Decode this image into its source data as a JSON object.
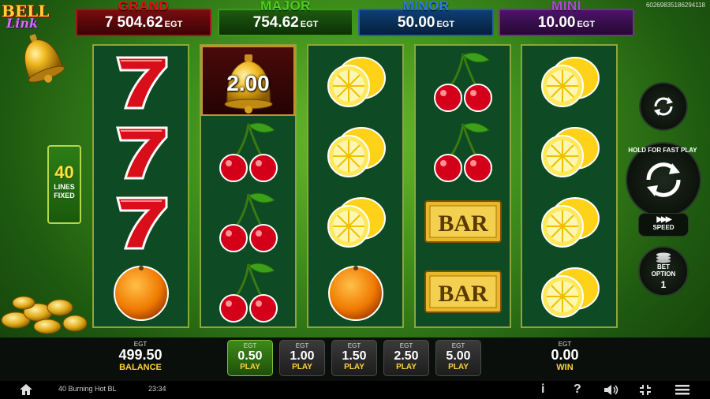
{
  "logo": {
    "title": "BELL",
    "subtitle": "Link"
  },
  "game_id": "60269835186294118",
  "jackpots": [
    {
      "name": "GRAND",
      "value": "7 504.62",
      "currency": "EGT"
    },
    {
      "name": "MAJOR",
      "value": "754.62",
      "currency": "EGT"
    },
    {
      "name": "MINOR",
      "value": "50.00",
      "currency": "EGT"
    },
    {
      "name": "MINI",
      "value": "10.00",
      "currency": "EGT"
    }
  ],
  "lines": {
    "count": "40",
    "label1": "LINES",
    "label2": "FIXED"
  },
  "reels": [
    [
      "seven-symbol",
      "seven-symbol",
      "seven-symbol",
      "orange-symbol"
    ],
    [
      "bell-symbol",
      "cherry-symbol",
      "cherry-symbol",
      "cherry-symbol"
    ],
    [
      "lemon-symbol",
      "lemon-symbol",
      "lemon-symbol",
      "orange-symbol"
    ],
    [
      "cherry-symbol",
      "cherry-symbol",
      "bar-symbol",
      "bar-symbol"
    ],
    [
      "lemon-symbol",
      "lemon-symbol",
      "lemon-symbol",
      "lemon-symbol"
    ]
  ],
  "bell_value": "2.00",
  "bar_text": "BAR",
  "controls": {
    "play_label": "HOLD FOR FAST PLAY",
    "speed_label": "SPEED",
    "bet_option_label1": "BET",
    "bet_option_label2": "OPTION",
    "bet_option_value": "1"
  },
  "balance": {
    "currency": "EGT",
    "value": "499.50",
    "label": "BALANCE"
  },
  "win": {
    "currency": "EGT",
    "value": "0.00",
    "label": "WIN"
  },
  "bets": [
    {
      "currency": "EGT",
      "value": "0.50",
      "label": "PLAY",
      "active": true
    },
    {
      "currency": "EGT",
      "value": "1.00",
      "label": "PLAY",
      "active": false
    },
    {
      "currency": "EGT",
      "value": "1.50",
      "label": "PLAY",
      "active": false
    },
    {
      "currency": "EGT",
      "value": "2.50",
      "label": "PLAY",
      "active": false
    },
    {
      "currency": "EGT",
      "value": "5.00",
      "label": "PLAY",
      "active": false
    }
  ],
  "footer": {
    "game_name": "40 Burning Hot BL",
    "time": "23:34"
  },
  "colors": {
    "grand": "#e0111a",
    "major": "#4bd21f",
    "minor": "#2e7be0",
    "mini": "#b048d6",
    "accent": "#ffd23a"
  }
}
